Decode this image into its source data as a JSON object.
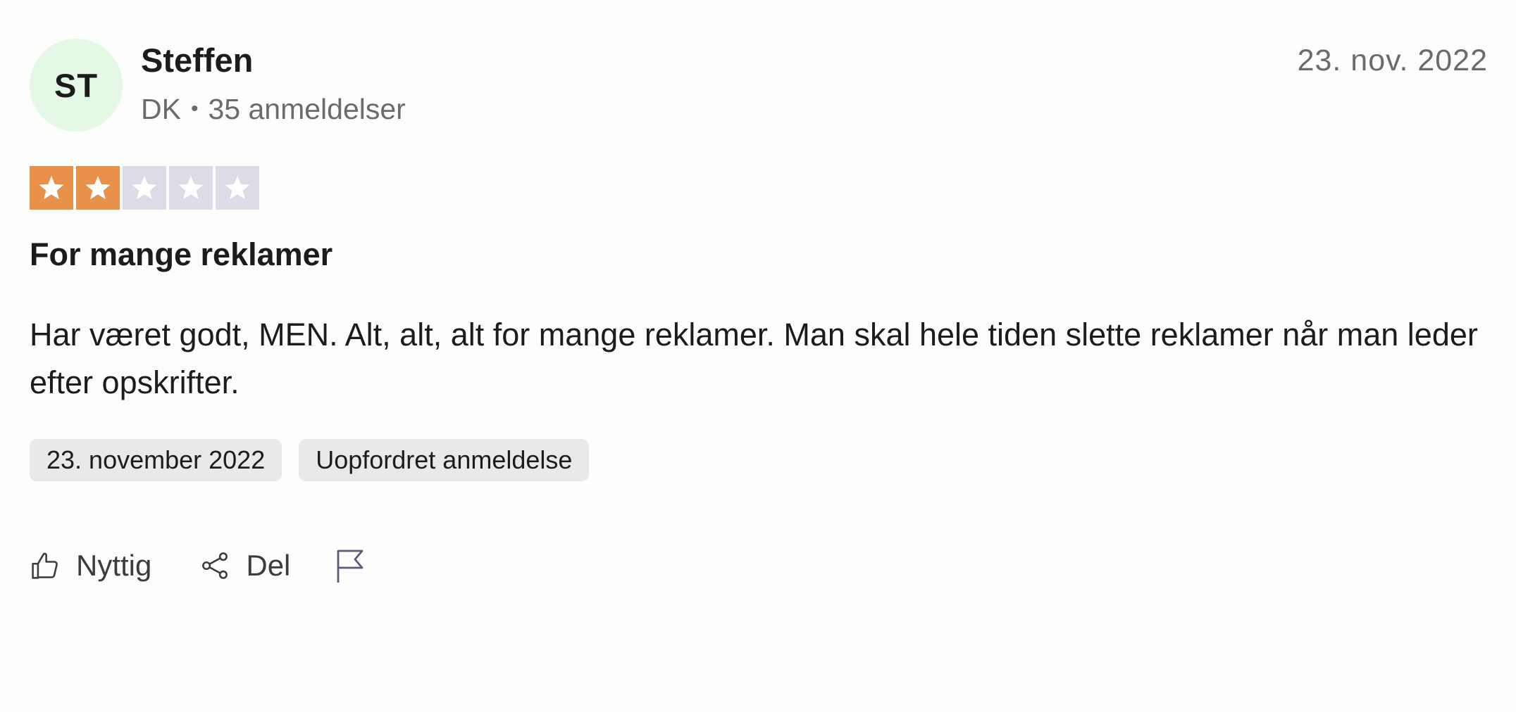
{
  "reviewer": {
    "initials": "ST",
    "name": "Steffen",
    "country": "DK",
    "separator": "•",
    "review_count": "35 anmeldelser"
  },
  "review": {
    "date_short": "23. nov. 2022",
    "rating": 2,
    "rating_max": 5,
    "title": "For mange reklamer",
    "text": "Har været godt, MEN. Alt, alt, alt for mange reklamer. Man skal hele tiden slette reklamer når man leder efter opskrifter.",
    "tags": [
      "23. november 2022",
      "Uopfordret anmeldelse"
    ]
  },
  "actions": {
    "useful_label": "Nyttig",
    "share_label": "Del",
    "useful_icon": "thumbs-up-icon",
    "share_icon": "share-icon",
    "report_icon": "flag-icon"
  },
  "colors": {
    "star_filled": "#e8914a",
    "star_empty": "#dcdce6",
    "avatar_bg": "#e5f8e5",
    "tag_bg": "#e9e9e9"
  }
}
